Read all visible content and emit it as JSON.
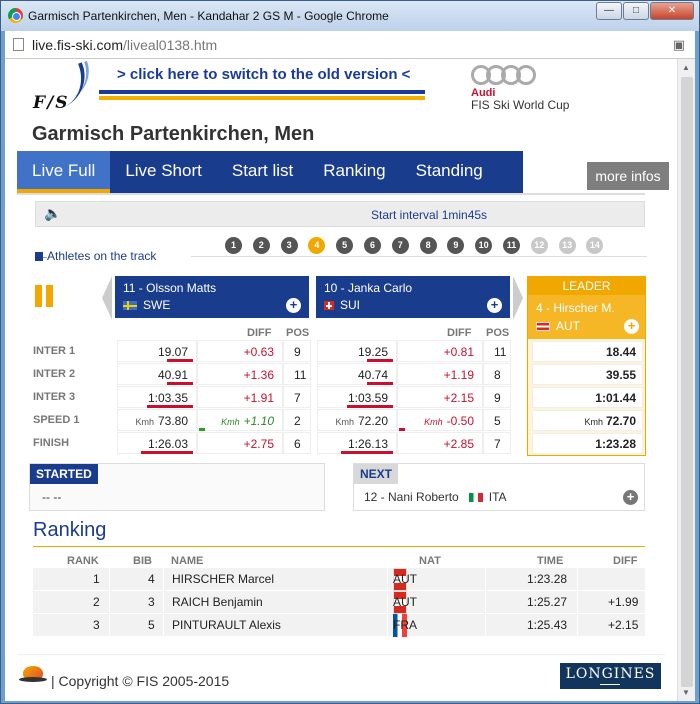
{
  "window": {
    "title": "Garmisch Partenkirchen, Men - Kandahar 2 GS M - Google Chrome",
    "url_host": "live.fis-ski.com",
    "url_path": "/liveal0138.htm",
    "buttons": [
      "minimize",
      "maximize",
      "close"
    ]
  },
  "header": {
    "fis_logo_text": "F/S",
    "switch_link": "> click here to switch to the old version <",
    "sponsor_line1": "Audi",
    "sponsor_line2": "FIS Ski World Cup",
    "race_title": "Garmisch Partenkirchen, Men"
  },
  "tabs": [
    {
      "label": "Live Full",
      "active": true
    },
    {
      "label": "Live Short",
      "active": false
    },
    {
      "label": "Start list",
      "active": false
    },
    {
      "label": "Ranking",
      "active": false
    },
    {
      "label": "Standing",
      "active": false
    }
  ],
  "more_infos": "more infos",
  "info_bar": {
    "text": "Start interval 1min45s",
    "icon": "speaker-icon"
  },
  "track": {
    "label": "Athletes on the track",
    "bibs": [
      {
        "n": "1",
        "state": "done"
      },
      {
        "n": "2",
        "state": "done"
      },
      {
        "n": "3",
        "state": "done"
      },
      {
        "n": "4",
        "state": "current"
      },
      {
        "n": "5",
        "state": "done"
      },
      {
        "n": "6",
        "state": "done"
      },
      {
        "n": "7",
        "state": "done"
      },
      {
        "n": "8",
        "state": "done"
      },
      {
        "n": "9",
        "state": "done"
      },
      {
        "n": "10",
        "state": "done"
      },
      {
        "n": "11",
        "state": "done"
      },
      {
        "n": "12",
        "state": "future"
      },
      {
        "n": "13",
        "state": "future"
      },
      {
        "n": "14",
        "state": "future"
      }
    ]
  },
  "athletes": [
    {
      "name": "11 - Olsson Matts",
      "nat": "SWE",
      "splits": [
        {
          "time": "19.07",
          "diff": "+0.63",
          "pos": "9"
        },
        {
          "time": "40.91",
          "diff": "+1.36",
          "pos": "11"
        },
        {
          "time": "1:03.35",
          "diff": "+1.91",
          "pos": "7"
        },
        {
          "time": "73.80",
          "time_unit": "Kmh",
          "diff": "+1.10",
          "diff_unit": "Kmh",
          "pos": "2"
        },
        {
          "time": "1:26.03",
          "diff": "+2.75",
          "pos": "6"
        }
      ]
    },
    {
      "name": "10 - Janka Carlo",
      "nat": "SUI",
      "splits": [
        {
          "time": "19.25",
          "diff": "+0.81",
          "pos": "11"
        },
        {
          "time": "40.74",
          "diff": "+1.19",
          "pos": "8"
        },
        {
          "time": "1:03.59",
          "diff": "+2.15",
          "pos": "9"
        },
        {
          "time": "72.20",
          "time_unit": "Kmh",
          "diff": "-0.50",
          "diff_unit": "Kmh",
          "pos": "5"
        },
        {
          "time": "1:26.13",
          "diff": "+2.85",
          "pos": "7"
        }
      ]
    }
  ],
  "split_headers": {
    "diff": "DIFF",
    "pos": "POS"
  },
  "split_labels": [
    "INTER 1",
    "INTER 2",
    "INTER 3",
    "SPEED 1",
    "FINISH"
  ],
  "leader": {
    "heading": "LEADER",
    "name": "4 - Hirscher M.",
    "nat": "AUT",
    "values": [
      "18.44",
      "39.55",
      "1:01.44",
      "72.70",
      "1:23.28"
    ],
    "speed_unit": "Kmh"
  },
  "started": {
    "heading": "STARTED",
    "value": "-- --"
  },
  "next": {
    "heading": "NEXT",
    "value": "12 - Nani Roberto",
    "nat": "ITA"
  },
  "ranking": {
    "title": "Ranking",
    "headers": {
      "rank": "RANK",
      "bib": "BIB",
      "name": "NAME",
      "nat": "NAT",
      "time": "TIME",
      "diff": "DIFF"
    },
    "rows": [
      {
        "rank": "1",
        "bib": "4",
        "name": "HIRSCHER Marcel",
        "nat": "AUT",
        "time": "1:23.28",
        "diff": ""
      },
      {
        "rank": "2",
        "bib": "3",
        "name": "RAICH Benjamin",
        "nat": "AUT",
        "time": "1:25.27",
        "diff": "+1.99"
      },
      {
        "rank": "3",
        "bib": "5",
        "name": "PINTURAULT Alexis",
        "nat": "FRA",
        "time": "1:25.43",
        "diff": "+2.15"
      }
    ]
  },
  "footer": {
    "copyright": "| Copyright © FIS 2005-2015",
    "sponsor": "LONGINES"
  }
}
